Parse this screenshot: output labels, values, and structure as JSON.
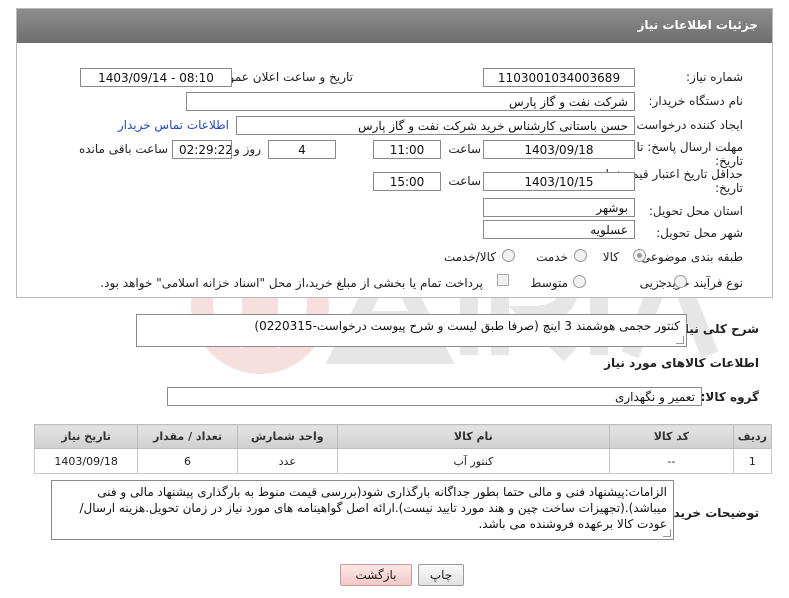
{
  "header": {
    "title": "جزئیات اطلاعات نیاز"
  },
  "fields": {
    "need_number_label": "شماره نیاز:",
    "need_number": "1103001034003689",
    "announce_label": "تاریخ و ساعت اعلان عمومی:",
    "announce_value": "1403/09/14 - 08:10",
    "buyer_org_label": "نام دستگاه خریدار:",
    "buyer_org": "شرکت نفت و گاز پارس",
    "requester_label": "ایجاد کننده درخواست:",
    "requester": "حسن باستانی کارشناس خرید شرکت نفت و گاز پارس",
    "contact_link": "اطلاعات تماس خریدار",
    "deadline_label_1": "مهلت ارسال پاسخ: تا",
    "deadline_label_2": "تاریخ:",
    "deadline_date": "1403/09/18",
    "time_label": "ساعت",
    "deadline_time": "11:00",
    "days_value": "4",
    "days_label": "روز و",
    "remaining_time": "02:29:22",
    "remaining_label": "ساعت باقی مانده",
    "validity_label_1": "حداقل تاریخ اعتبار قیمت: تا",
    "validity_label_2": "تاریخ:",
    "validity_date": "1403/10/15",
    "validity_time_label": "ساعت",
    "validity_time": "15:00",
    "province_label": "استان محل تحویل:",
    "province": "بوشهر",
    "city_label": "شهر محل تحویل:",
    "city": "عسلویه",
    "category_label": "طبقه بندی موضوعی:",
    "category_options": [
      "کالا",
      "خدمت",
      "کالا/خدمت"
    ],
    "category_selected": "کالا",
    "process_label": "نوع فرآیند خرید :",
    "process_options": [
      "جزیی",
      "متوسط"
    ],
    "payment_note": "پرداخت تمام یا بخشی از مبلغ خرید،از محل \"اسناد خزانه اسلامی\" خواهد بود."
  },
  "description": {
    "label": "شرح کلی نیاز:",
    "text": "کنتور حجمی هوشمند 3 اینچ  (صرفا طبق لیست و شرح پیوست درخواست-0220315)"
  },
  "goods": {
    "section_title": "اطلاعات کالاهای مورد نیاز",
    "group_label": "گروه کالا:",
    "group_value": "تعمیر و نگهداری",
    "columns": [
      "ردیف",
      "کد کالا",
      "نام کالا",
      "واحد شمارش",
      "تعداد / مقدار",
      "تاریخ نیاز"
    ],
    "rows": [
      {
        "row": "1",
        "code": "--",
        "name": "کنتور آب",
        "unit": "عدد",
        "qty": "6",
        "date": "1403/09/18"
      }
    ]
  },
  "buyer_notes": {
    "label": "توضیحات خریدار:",
    "text": "الزامات:پیشنهاد فنی و مالی حتما  بطور جداگانه بارگذاری شود(بررسی قیمت منوط به بارگذاری پیشنهاد مالی و فنی میباشد).(تجهیزات ساخت چین و هند مورد تایید نیست).ارائه اصل گواهینامه های مورد نیاز در زمان تحویل.هزینه ارسال/عودت کالا برعهده فروشنده می باشد."
  },
  "buttons": {
    "print": "چاپ",
    "back": "بازگشت"
  }
}
